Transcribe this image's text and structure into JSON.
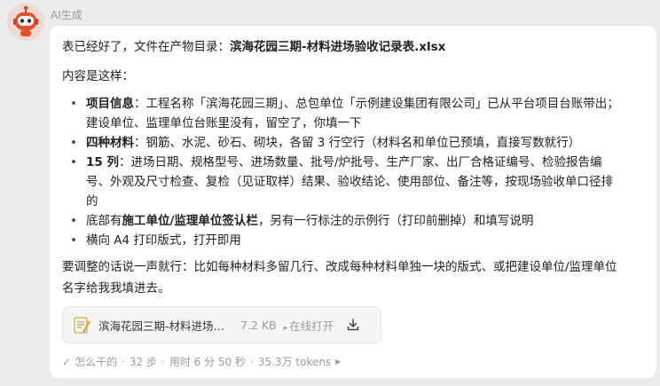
{
  "sender": {
    "name": "AI生成"
  },
  "message": {
    "lead_prefix": "表已经好了，文件在产物目录：",
    "lead_file": "滨海花园三期-材料进场验收记录表.xlsx",
    "intro": "内容是这样：",
    "points": [
      {
        "bold": "项目信息",
        "text1": "：工程名称「滨海花园三期」、总包单位「示例建设集团有限公司」已从平台项目台账带出；",
        "text2": "建设单位、监理单位台账里没有，留空了，你填一下"
      },
      {
        "bold": "四种材料",
        "text1": "：钢筋、水泥、砂石、砌块，各留 3 行空行（材料名和单位已预填，直接写数就行）"
      },
      {
        "bold": "15 列",
        "text1": "：进场日期、规格型号、进场数量、批号/炉批号、生产厂家、出厂合格证编号、检验报告编",
        "text2": "号、外观及尺寸检查、复检（见证取样）结果、验收结论、使用部位、备注等，按现场验收单口径排",
        "text3": "的"
      },
      {
        "pre": "底部有",
        "bold": "施工单位/监理单位签认栏",
        "text1": "，另有一行标注的示例行（打印前删掉）和填写说明"
      },
      {
        "text1": "横向 A4 打印版式，打开即用"
      }
    ],
    "closing1": "要调整的话说一声就行：比如每种材料多留几行、改成每种材料单独一块的版式、或把建设单位/监理单位",
    "closing2": "名字给我我填进去。"
  },
  "file_card": {
    "name": "滨海花园三期-材料进场验…",
    "size": "7.2 KB",
    "open_label": "在线打开",
    "icon": "memo-icon"
  },
  "meta": {
    "label": "怎么干的",
    "steps": "32 步",
    "time": "用时 6 分 50 秒",
    "tokens": "35.3万 tokens"
  }
}
